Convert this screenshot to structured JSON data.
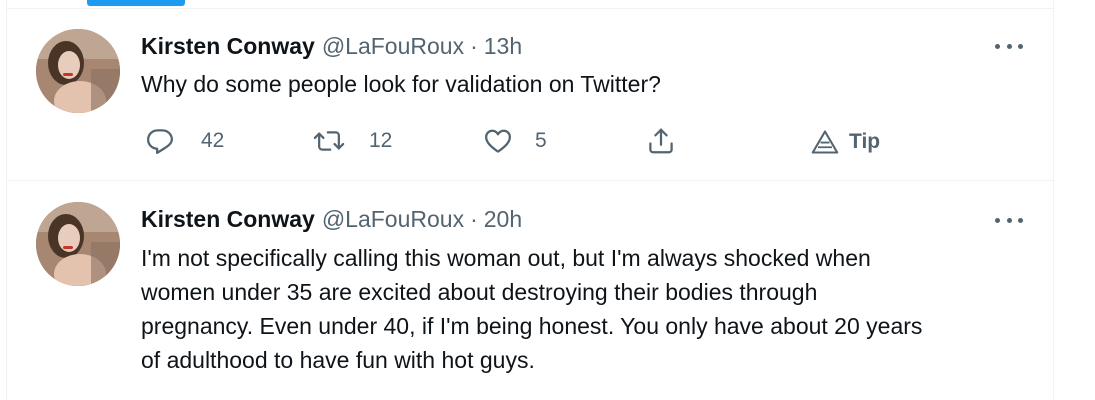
{
  "tweets": [
    {
      "author_name": "Kirsten Conway",
      "handle": "@LaFouRoux",
      "separator": "·",
      "time": "13h",
      "text": "Why do some people look for validation on Twitter?",
      "reply_count": "42",
      "retweet_count": "12",
      "like_count": "5",
      "tip_label": "Tip"
    },
    {
      "author_name": "Kirsten Conway",
      "handle": "@LaFouRoux",
      "separator": "·",
      "time": "20h",
      "text": "I'm not specifically calling this woman out, but I'm always shocked when\nwomen under 35 are excited about destroying their bodies through\npregnancy. Even under 40, if I'm being honest. You only have about 20 years\nof adulthood to have fun with hot guys."
    }
  ],
  "icons": {
    "more": "more-horizontal-icon",
    "reply": "reply-icon",
    "retweet": "retweet-icon",
    "like": "heart-icon",
    "share": "share-icon",
    "tip": "tip-icon"
  },
  "colors": {
    "accent": "#1d9bf0",
    "text_primary": "#0f1419",
    "text_secondary": "#536471",
    "divider": "#eff3f4"
  }
}
